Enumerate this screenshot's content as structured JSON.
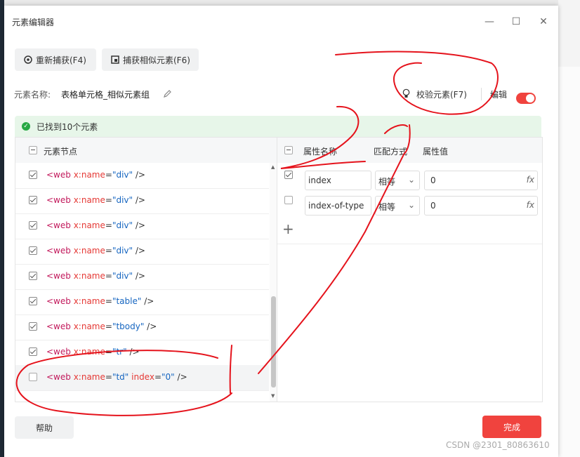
{
  "dialog": {
    "title": "元素编辑器",
    "minimize": "—",
    "maximize": "☐",
    "close": "✕"
  },
  "toolbar": {
    "recapture_label": "重新捕获(F4)",
    "capture_similar_label": "捕获相似元素(F6)"
  },
  "element": {
    "name_label": "元素名称:",
    "name_value": "表格单元格_相似元素组",
    "verify_label": "校验元素(F7)",
    "edit_label": "编辑",
    "edit_on": true
  },
  "status": {
    "found_text": "已找到10个元素",
    "color": "#27a844"
  },
  "nodes": {
    "header": "元素节点",
    "rows": [
      {
        "checked": true,
        "name": "div",
        "extra": ""
      },
      {
        "checked": true,
        "name": "div",
        "extra": ""
      },
      {
        "checked": true,
        "name": "div",
        "extra": ""
      },
      {
        "checked": true,
        "name": "div",
        "extra": ""
      },
      {
        "checked": true,
        "name": "div",
        "extra": ""
      },
      {
        "checked": true,
        "name": "table",
        "extra": ""
      },
      {
        "checked": true,
        "name": "tbody",
        "extra": ""
      },
      {
        "checked": true,
        "name": "tr",
        "extra": ""
      },
      {
        "checked": false,
        "name": "td",
        "extra": "0"
      }
    ],
    "prefix": "<web ",
    "attr_name": "x:name",
    "eq": "=",
    "index_attr": " index",
    "suffix": " />"
  },
  "attributes": {
    "headers": {
      "name": "属性名称",
      "match": "匹配方式",
      "value": "属性值"
    },
    "rows": [
      {
        "checked": true,
        "name": "index",
        "match": "相等",
        "value": "0"
      },
      {
        "checked": false,
        "name": "index-of-type",
        "match": "相等",
        "value": "0"
      }
    ],
    "fx": "fx",
    "add": "+"
  },
  "footer": {
    "help_label": "帮助",
    "done_label": "完成",
    "done_color": "#f0433e"
  },
  "watermark": "CSDN @2301_80863610"
}
